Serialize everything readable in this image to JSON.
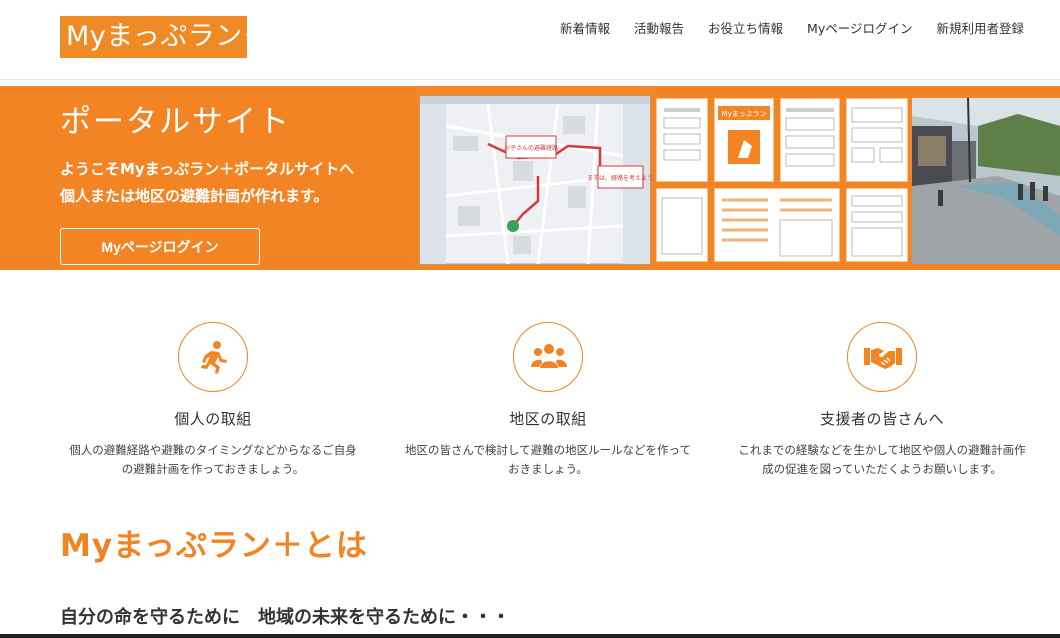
{
  "header": {
    "logo": "Myまっぷラン＋",
    "nav": [
      "新着情報",
      "活動報告",
      "お役立ち情報",
      "Myページログイン",
      "新規利用者登録"
    ]
  },
  "hero": {
    "title": "ポータルサイト",
    "line1": "ようこそMyまっぷラン＋ポータルサイトへ",
    "line2": "個人または地区の避難計画が作れます。",
    "button": "Myページログイン",
    "images": {
      "map_note_1": "お子さんの避難経路",
      "map_note_2": "まずは、経路を考えよう",
      "form_title": "Myまっぷラン"
    }
  },
  "features": [
    {
      "icon": "running-person-icon",
      "title": "個人の取組",
      "text_1": "個人の避難経路や避難のタイミングなどからなるご自身",
      "text_2": "の避難計画を作っておきましょう。"
    },
    {
      "icon": "people-group-icon",
      "title": "地区の取組",
      "text_1": "地区の皆さんで検討して避難の地区ルールなどを作って",
      "text_2": "おきましょう。"
    },
    {
      "icon": "handshake-icon",
      "title": "支援者の皆さんへ",
      "text_1": "これまでの経験などを生かして地区や個人の避難計画作",
      "text_2": "成の促進を図っていただくようお願いします。"
    }
  ],
  "about": {
    "title": "Myまっぷラン＋とは",
    "subtitle": "自分の命を守るために　地域の未来を守るために・・・"
  },
  "colors": {
    "accent": "#f28424",
    "text": "#333333"
  }
}
